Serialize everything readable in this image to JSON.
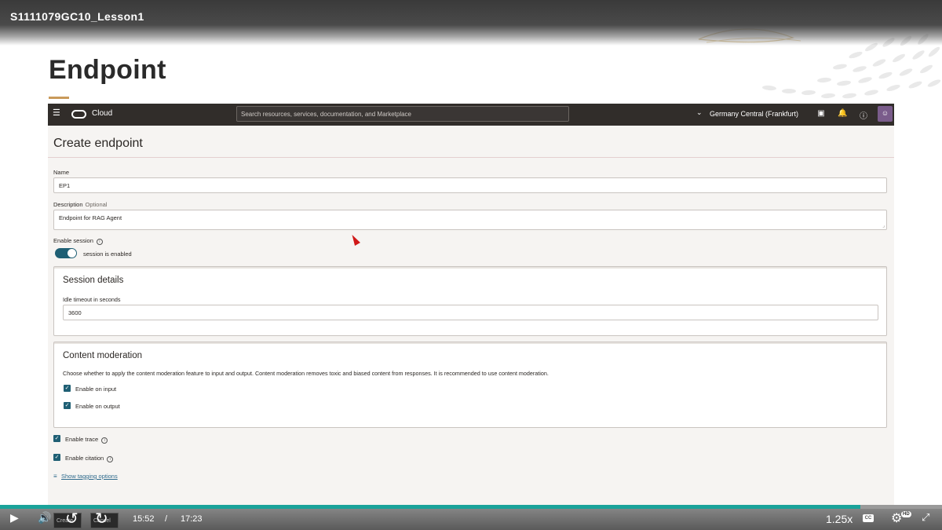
{
  "video": {
    "title": "S1111079GC10_Lesson1",
    "current_time": "15:52",
    "separator": "/",
    "duration": "17:23",
    "progress": 0.913,
    "speed": "1.25x",
    "hd_badge": "HD",
    "cc_label": "CC",
    "overlay_left": "Create",
    "overlay_right": "Cancel",
    "accent_color": "#1aa39a"
  },
  "slide": {
    "title": "Endpoint",
    "accent_color": "#c99a5a"
  },
  "console": {
    "nav": {
      "brand": "Cloud",
      "search_placeholder": "Search resources, services, documentation, and Marketplace",
      "region": "Germany Central (Frankfurt)",
      "icons": [
        "menu-icon",
        "cloud-shell-icon",
        "bell-icon",
        "help-icon",
        "user-icon"
      ]
    },
    "heading": "Create endpoint",
    "name_label": "Name",
    "name_value": "EP1",
    "description_label": "Description",
    "description_optional": "Optional",
    "description_value": "Endpoint for RAG Agent",
    "enable_session_label": "Enable session",
    "session_toggle_text": "session is enabled",
    "session_details": {
      "title": "Session details",
      "idle_label": "Idle timeout in seconds",
      "idle_value": "3600"
    },
    "content_moderation": {
      "title": "Content moderation",
      "description": "Choose whether to apply the content moderation feature to input and output. Content moderation removes toxic and biased content from responses. It is recommended to use content moderation.",
      "input_label": "Enable on input",
      "output_label": "Enable on output"
    },
    "enable_trace_label": "Enable trace",
    "enable_citation_label": "Enable citation",
    "tagging_link": "Show tagging options",
    "toggle_color": "#1f5f74",
    "link_color": "#2e6a8c"
  }
}
